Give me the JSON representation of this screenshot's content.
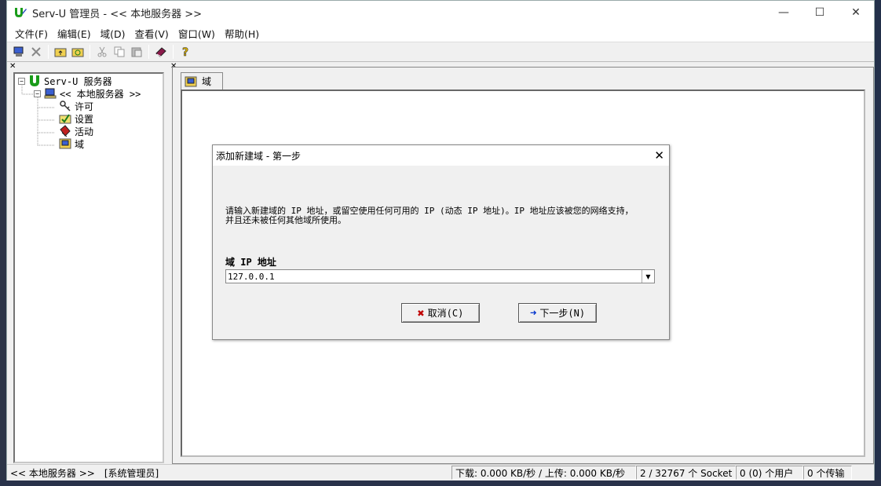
{
  "window": {
    "title": "Serv-U 管理员 - << 本地服务器 >>",
    "minimize": "—",
    "maximize": "☐",
    "close": "✕"
  },
  "menu": [
    "文件(F)",
    "编辑(E)",
    "域(D)",
    "查看(V)",
    "窗口(W)",
    "帮助(H)"
  ],
  "tree": {
    "root": "Serv-U 服务器",
    "server": "<< 本地服务器 >>",
    "children": [
      "许可",
      "设置",
      "活动",
      "域"
    ]
  },
  "tab": {
    "label": "域"
  },
  "dialog": {
    "title": "添加新建域 - 第一步",
    "message_line1": "请输入新建域的 IP 地址，或留空使用任何可用的 IP (动态 IP 地址)。IP 地址应该被您的网络支持，",
    "message_line2": "并且还未被任何其他域所使用。",
    "field_label": "域 IP 地址",
    "field_value": "127.0.0.1",
    "cancel_label": "取消(C)",
    "next_label": "下一步(N)"
  },
  "status": {
    "server": "<< 本地服务器 >>",
    "role": "[系统管理员]",
    "transfer": "下载: 0.000 KB/秒 / 上传: 0.000 KB/秒",
    "sockets": "2 / 32767 个 Socket",
    "users": "0 (0) 个用户",
    "transfers": "0 个传输"
  },
  "colors": {
    "accent_green": "#1a9c1a",
    "cancel_red": "#c00000",
    "next_blue": "#0033cc"
  }
}
